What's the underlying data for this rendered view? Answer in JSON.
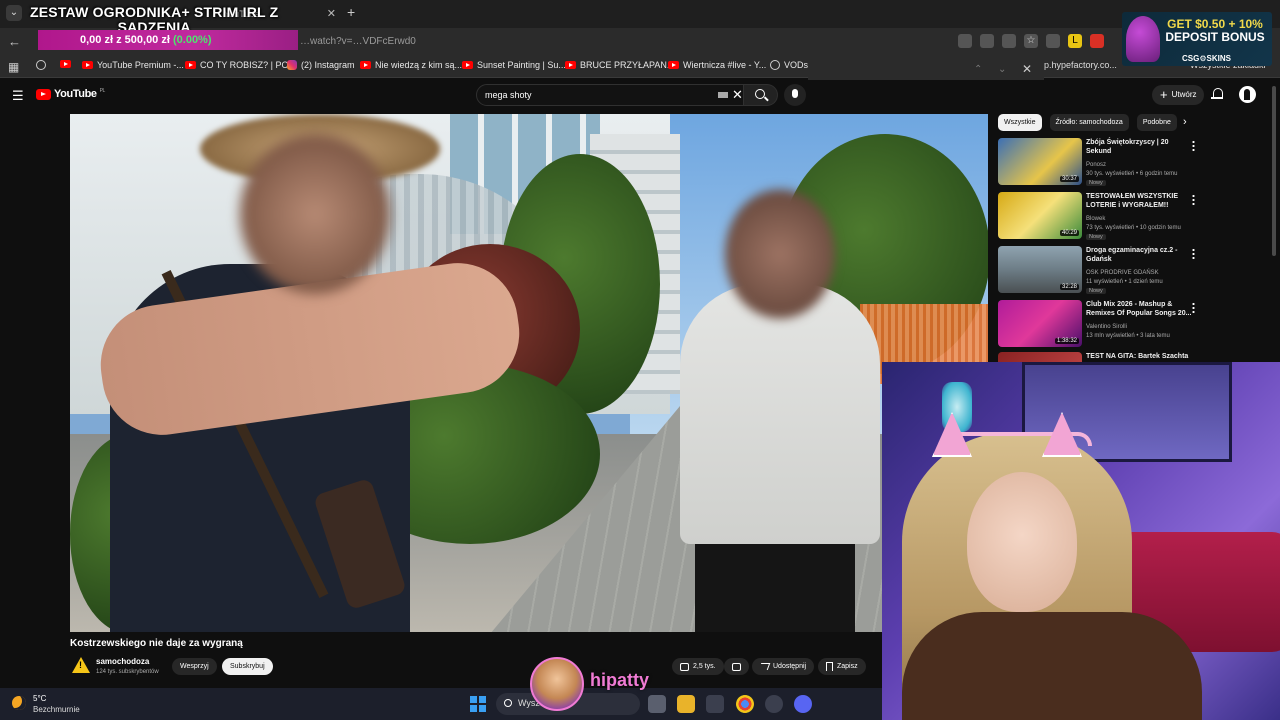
{
  "stream": {
    "title_line1": "ZESTAW OGRODNIKA+ STRIM IRL Z",
    "title_line2": "SADZENIA",
    "goal_current": "0,00 zł",
    "goal_sep": "z",
    "goal_target": "500,00 zł",
    "goal_percent": "(0.00%)",
    "streamer_name": "hipatty"
  },
  "browser": {
    "tab_title": "YouTube",
    "address": "…watch?v=…VDFcErwd0",
    "bookmarks": [
      {
        "label": "YouTube Premium -...",
        "icon": "youtube-icon"
      },
      {
        "label": "CO TY ROBISZ? | PO...",
        "icon": "youtube-icon"
      },
      {
        "label": "(2) Instagram",
        "icon": "instagram-icon"
      },
      {
        "label": "Nie wiedzą z kim są...",
        "icon": "youtube-icon"
      },
      {
        "label": "Sunset Painting | Su...",
        "icon": "youtube-icon"
      },
      {
        "label": "BRUCE PRZYŁAPAN...",
        "icon": "youtube-icon"
      },
      {
        "label": "Wiertnicza #live - Y...",
        "icon": "youtube-icon"
      },
      {
        "label": "VODs",
        "icon": "globe-icon"
      }
    ],
    "hype_bookmark": "p.hypefactory.co...",
    "all_bookmarks": "Wszystkie zakładki"
  },
  "ad": {
    "line1": "GET $0.50 + 10%",
    "line2": "DEPOSIT BONUS",
    "brand": "CSG⚙SKINS"
  },
  "youtube": {
    "logo": "YouTube",
    "logo_region": "PL",
    "search_value": "mega shoty",
    "create_label": "Utwórz",
    "video_title": "Kostrzewskiego nie daje za wygraną",
    "channel_name": "samochodoza",
    "channel_subs": "124 tys. subskrybentów",
    "support_label": "Wesprzyj",
    "subscribe_label": "Subskrybuj",
    "likes": "2,5 tys.",
    "share_label": "Udostępnij",
    "save_label": "Zapisz",
    "chips": [
      "Wszystkie",
      "Źródło: samochodoza",
      "Podobne"
    ],
    "recommendations": [
      {
        "title": "Zbója Świętokrzyscy | 20 Sekund",
        "channel": "Ponosz",
        "meta": "30 tys. wyświetleń • 6 godzin temu",
        "badge": "Nowy",
        "duration": "30:37",
        "thumb_color": "#3b6fb5"
      },
      {
        "title": "TESTOWAŁEM WSZYSTKIE LOTERIE i WYGRAŁEM!!",
        "channel": "Blowek",
        "meta": "73 tys. wyświetleń • 10 godzin temu",
        "badge": "Nowy",
        "duration": "40:29",
        "thumb_color": "#d6a915"
      },
      {
        "title": "Droga egzaminacyjna cz.2 - Gdańsk",
        "channel": "OSK PRODRIVE GDAŃSK",
        "meta": "11 wyświetleń • 1 dzień temu",
        "badge": "Nowy",
        "duration": "32:28",
        "thumb_color": "#6d7d86"
      },
      {
        "title": "Club Mix 2026 - Mashup & Remixes Of Popular Songs 20...",
        "channel": "Valentino Sirolli",
        "meta": "13 mln wyświetleń • 3 lata temu",
        "badge": "",
        "duration": "1:38:32",
        "thumb_color": "#b01c9a"
      },
      {
        "title": "TEST NA GITA: Bartek Szachta",
        "channel": "",
        "meta": "",
        "badge": "",
        "duration": "",
        "thumb_color": "#8a2222"
      }
    ]
  },
  "taskbar": {
    "temperature": "5°C",
    "weather": "Bezchmurnie",
    "search_placeholder": "Wyszukaj"
  }
}
